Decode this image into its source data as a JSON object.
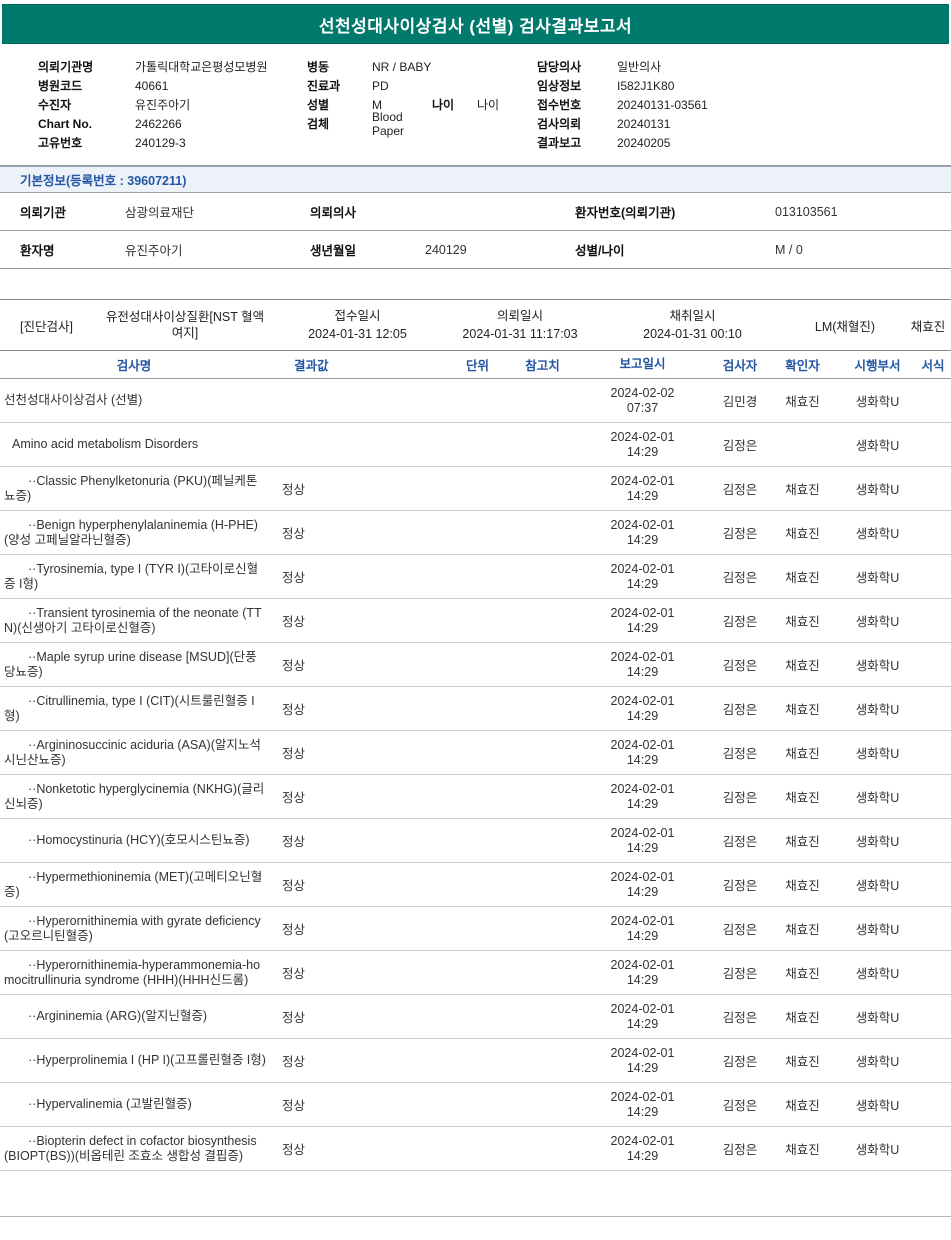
{
  "title": "선천성대사이상검사 (선별) 검사결과보고서",
  "header": {
    "left": [
      {
        "label": "의뢰기관명",
        "value": "가톨릭대학교은평성모병원"
      },
      {
        "label": "병원코드",
        "value": "40661"
      },
      {
        "label": "수진자",
        "value": "유진주아기"
      },
      {
        "label": "Chart No.",
        "value": "2462266"
      },
      {
        "label": "고유번호",
        "value": "240129-3"
      }
    ],
    "middle": [
      {
        "label": "병동",
        "value": "NR / BABY"
      },
      {
        "label": "진료과",
        "value": "PD"
      },
      {
        "label": "성별",
        "value": "M",
        "label2": "나이",
        "value2": "나이"
      },
      {
        "label": "검체",
        "value": "Blood Paper"
      }
    ],
    "right": [
      {
        "label": "담당의사",
        "value": "일반의사"
      },
      {
        "label": "임상정보",
        "value": "I582J1K80"
      },
      {
        "label": "접수번호",
        "value": "20240131-03561"
      },
      {
        "label": "검사의뢰",
        "value": "20240131"
      },
      {
        "label": "결과보고",
        "value": "20240205"
      }
    ]
  },
  "basic_info": {
    "banner": "기본정보(등록번호 : 39607211)",
    "rows": [
      [
        {
          "label": "의뢰기관",
          "value": "삼광의료재단"
        },
        {
          "label": "의뢰의사",
          "value": ""
        },
        {
          "label": "환자번호(의뢰기관)",
          "value": "013103561"
        }
      ],
      [
        {
          "label": "환자명",
          "value": "유진주아기"
        },
        {
          "label": "생년월일",
          "value": "240129"
        },
        {
          "label": "성별/나이",
          "value": "M / 0"
        }
      ]
    ]
  },
  "exam": {
    "tag": "[진단검사]",
    "name": "유전성대사이상질환[NST 혈액여지]",
    "times": [
      {
        "label": "접수일시",
        "value": "2024-01-31 12:05"
      },
      {
        "label": "의뢰일시",
        "value": "2024-01-31 11:17:03"
      },
      {
        "label": "채취일시",
        "value": "2024-01-31 00:10"
      }
    ],
    "collector": "LM(채혈진)",
    "confirmer": "채효진"
  },
  "results_table": {
    "headers": [
      "검사명",
      "결과값",
      "단위",
      "참고치",
      "보고일시",
      "검사자",
      "확인자",
      "시행부서",
      "서식"
    ],
    "rows": [
      {
        "name": "선천성대사이상검사 (선별)",
        "indent": 0,
        "result": "",
        "report_date": "2024-02-02",
        "report_time": "07:37",
        "tester": "김민경",
        "confirmer": "채효진",
        "dept": "생화학U"
      },
      {
        "name": "Amino acid metabolism Disorders",
        "indent": 1,
        "result": "",
        "report_date": "2024-02-01",
        "report_time": "14:29",
        "tester": "김정은",
        "confirmer": "",
        "dept": "생화학U"
      },
      {
        "name": "··Classic Phenylketonuria (PKU)(페닐케톤뇨증)",
        "indent": 2,
        "result": "정상",
        "report_date": "2024-02-01",
        "report_time": "14:29",
        "tester": "김정은",
        "confirmer": "채효진",
        "dept": "생화학U"
      },
      {
        "name": "··Benign hyperphenylalaninemia (H-PHE)(양성 고페닐알라닌혈증)",
        "indent": 2,
        "result": "정상",
        "report_date": "2024-02-01",
        "report_time": "14:29",
        "tester": "김정은",
        "confirmer": "채효진",
        "dept": "생화학U"
      },
      {
        "name": "··Tyrosinemia, type I (TYR I)(고타이로신혈증 I형)",
        "indent": 2,
        "result": "정상",
        "report_date": "2024-02-01",
        "report_time": "14:29",
        "tester": "김정은",
        "confirmer": "채효진",
        "dept": "생화학U"
      },
      {
        "name": "··Transient tyrosinemia of the neonate (TTN)(신생아기 고타이로신혈증)",
        "indent": 2,
        "result": "정상",
        "report_date": "2024-02-01",
        "report_time": "14:29",
        "tester": "김정은",
        "confirmer": "채효진",
        "dept": "생화학U"
      },
      {
        "name": "··Maple syrup urine disease [MSUD](단풍당뇨증)",
        "indent": 2,
        "result": "정상",
        "report_date": "2024-02-01",
        "report_time": "14:29",
        "tester": "김정은",
        "confirmer": "채효진",
        "dept": "생화학U"
      },
      {
        "name": "··Citrullinemia, type I (CIT)(시트룰린혈증 I형)",
        "indent": 2,
        "result": "정상",
        "report_date": "2024-02-01",
        "report_time": "14:29",
        "tester": "김정은",
        "confirmer": "채효진",
        "dept": "생화학U"
      },
      {
        "name": "··Argininosuccinic aciduria (ASA)(알지노석시닌산뇨증)",
        "indent": 2,
        "result": "정상",
        "report_date": "2024-02-01",
        "report_time": "14:29",
        "tester": "김정은",
        "confirmer": "채효진",
        "dept": "생화학U"
      },
      {
        "name": "··Nonketotic hyperglycinemia (NKHG)(글리신뇌증)",
        "indent": 2,
        "result": "정상",
        "report_date": "2024-02-01",
        "report_time": "14:29",
        "tester": "김정은",
        "confirmer": "채효진",
        "dept": "생화학U"
      },
      {
        "name": "··Homocystinuria (HCY)(호모시스틴뇨증)",
        "indent": 2,
        "result": "정상",
        "report_date": "2024-02-01",
        "report_time": "14:29",
        "tester": "김정은",
        "confirmer": "채효진",
        "dept": "생화학U"
      },
      {
        "name": "··Hypermethioninemia (MET)(고메티오닌혈증)",
        "indent": 2,
        "result": "정상",
        "report_date": "2024-02-01",
        "report_time": "14:29",
        "tester": "김정은",
        "confirmer": "채효진",
        "dept": "생화학U"
      },
      {
        "name": "··Hyperornithinemia with gyrate deficiency(고오르니틴혈증)",
        "indent": 2,
        "result": "정상",
        "report_date": "2024-02-01",
        "report_time": "14:29",
        "tester": "김정은",
        "confirmer": "채효진",
        "dept": "생화학U"
      },
      {
        "name": "··Hyperornithinemia-hyperammonemia-homocitrullinuria syndrome (HHH)(HHH신드롬)",
        "indent": 2,
        "result": "정상",
        "report_date": "2024-02-01",
        "report_time": "14:29",
        "tester": "김정은",
        "confirmer": "채효진",
        "dept": "생화학U"
      },
      {
        "name": "··Argininemia (ARG)(알지닌혈증)",
        "indent": 2,
        "result": "정상",
        "report_date": "2024-02-01",
        "report_time": "14:29",
        "tester": "김정은",
        "confirmer": "채효진",
        "dept": "생화학U"
      },
      {
        "name": "··Hyperprolinemia I (HP I)(고프롤린혈증 I형)",
        "indent": 2,
        "result": "정상",
        "report_date": "2024-02-01",
        "report_time": "14:29",
        "tester": "김정은",
        "confirmer": "채효진",
        "dept": "생화학U"
      },
      {
        "name": "··Hypervalinemia (고발린혈증)",
        "indent": 2,
        "result": "정상",
        "report_date": "2024-02-01",
        "report_time": "14:29",
        "tester": "김정은",
        "confirmer": "채효진",
        "dept": "생화학U"
      },
      {
        "name": "··Biopterin defect in cofactor biosynthesis (BIOPT(BS))(비옵테린 조효소 생합성 결핍증)",
        "indent": 2,
        "result": "정상",
        "report_date": "2024-02-01",
        "report_time": "14:29",
        "tester": "김정은",
        "confirmer": "채효진",
        "dept": "생화학U"
      }
    ]
  }
}
